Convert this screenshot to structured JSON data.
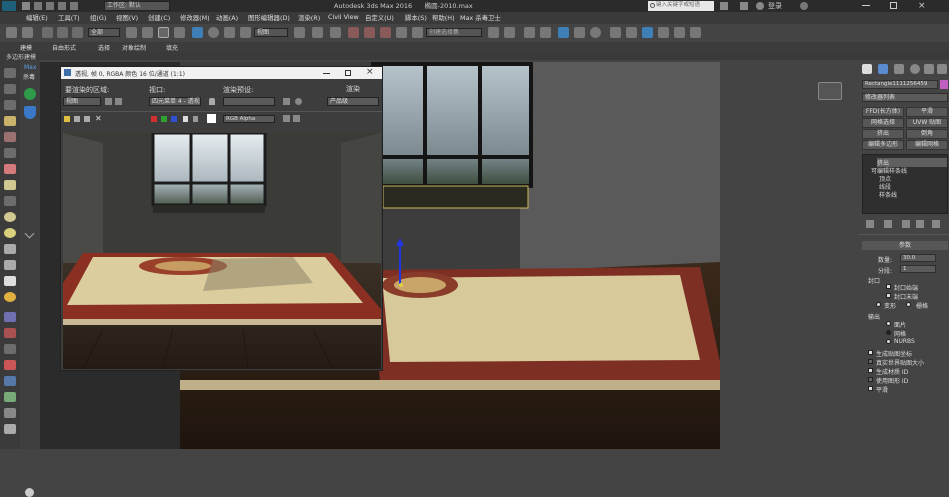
{
  "title": {
    "workspace": "工作区: 默认",
    "app": "Autodesk 3ds Max 2016",
    "file": "椭圆-2010.max",
    "search_placeholder": "键入关键字或短语",
    "login": "登录"
  },
  "menu": [
    "编辑(E)",
    "工具(T)",
    "组(G)",
    "视图(V)",
    "创建(C)",
    "修改器(M)",
    "动画(A)",
    "图形编辑器(D)",
    "渲染(R)",
    "Civil View",
    "自定义(U)",
    "脚本(S)",
    "帮助(H)",
    "Max 杀毒卫士"
  ],
  "toolbar": {
    "selection_filter": "全部",
    "ref_coord": "视图",
    "named_sel": "创建选择集"
  },
  "ribbon": {
    "tabs": [
      "建模",
      "自由形式",
      "选择",
      "对象绘制",
      "填充"
    ],
    "sub": "多边形建模"
  },
  "leftcmd": {
    "max_label": "Max",
    "kill_label": "杀毒"
  },
  "render": {
    "title": "透视, 帧 0, RGBA 颜色 16 位/通道 (1:1)",
    "area_label": "要渲染的区域:",
    "area_value": "视图",
    "viewport_label": "视口:",
    "viewport_value": "四元菜单 4 - 透视",
    "preset_label": "渲染预设:",
    "render_button": "渲染",
    "product_value": "产品级",
    "channel_value": "RGB Alpha"
  },
  "panel": {
    "object_name": "Rectangle1111256459",
    "modifier_list": "修改器列表",
    "buttons": [
      "FFD(长方体)",
      "平滑",
      "网格选择",
      "UVW 贴图",
      "挤出",
      "倒角",
      "编辑多边形",
      "编辑网格"
    ],
    "stack": [
      "挤出",
      "可编辑样条线",
      "顶点",
      "线段",
      "样条线"
    ],
    "params_title": "参数",
    "amount_label": "数量:",
    "amount_value": "30.0",
    "segments_label": "分段:",
    "segments_value": "1",
    "capping_title": "封口",
    "cap_start": "封口始端",
    "cap_end": "封口末端",
    "morph": "变形",
    "grid": "栅格",
    "output_title": "输出",
    "out_patch": "面片",
    "out_mesh": "网格",
    "out_nurbs": "NURBS",
    "gen_map": "生成贴图坐标",
    "real_world": "真实世界贴图大小",
    "gen_mat": "生成材质 ID",
    "use_shape": "使用图形 ID",
    "smooth": "平滑"
  }
}
